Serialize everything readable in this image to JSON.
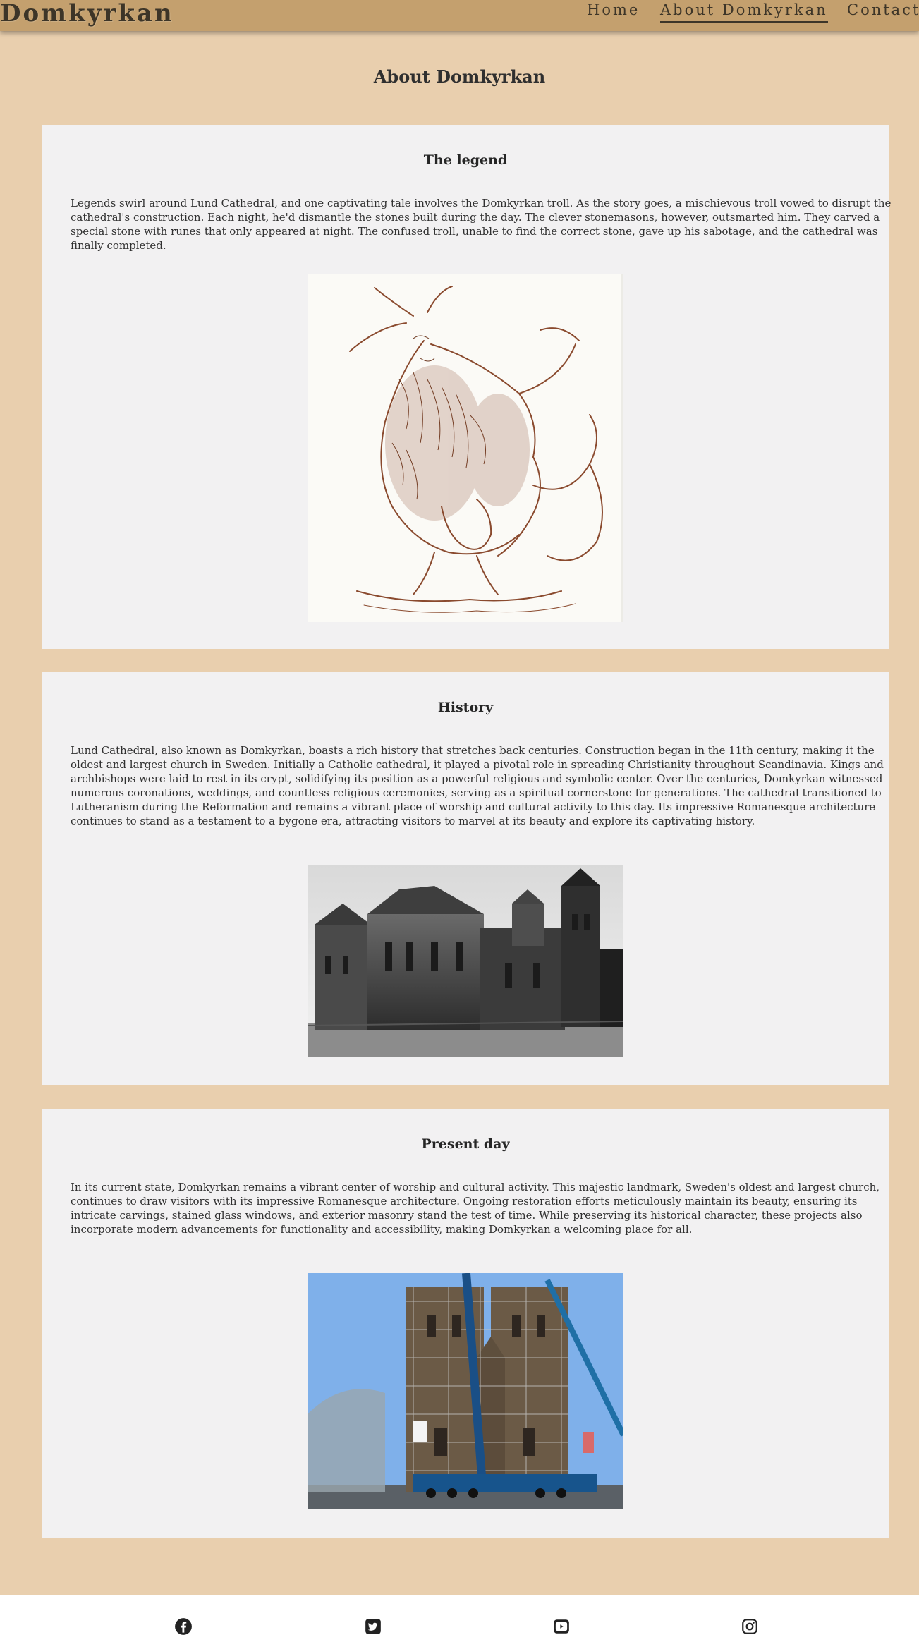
{
  "site": {
    "brand": "Domkyrkan"
  },
  "nav": {
    "items": [
      "Home",
      "About Domkyrkan",
      "Contact"
    ]
  },
  "page": {
    "title": "About Domkyrkan"
  },
  "sections": [
    {
      "heading": "The legend",
      "text": "Legends swirl around Lund Cathedral, and one captivating tale involves the Domkyrkan troll. As the story goes, a mischievous troll vowed to disrupt the cathedral's construction. Each night, he'd dismantle the stones built during the day. The clever stonemasons, however, outsmarted him. They carved a special stone with runes that only appeared at night. The confused troll, unable to find the correct stone, gave up his sabotage, and the cathedral was finally completed."
    },
    {
      "heading": "History",
      "text": "Lund Cathedral, also known as Domkyrkan, boasts a rich history that stretches back centuries. Construction began in the 11th century, making it the oldest and largest church in Sweden. Initially a Catholic cathedral, it played a pivotal role in spreading Christianity throughout Scandinavia. Kings and archbishops were laid to rest in its crypt, solidifying its position as a powerful religious and symbolic center. Over the centuries, Domkyrkan witnessed numerous coronations, weddings, and countless religious ceremonies, serving as a spiritual cornerstone for generations. The cathedral transitioned to Lutheranism during the Reformation and remains a vibrant place of worship and cultural activity to this day. Its impressive Romanesque architecture continues to stand as a testament to a bygone era, attracting visitors to marvel at its beauty and explore its captivating history."
    },
    {
      "heading": "Present day",
      "text": "In its current state, Domkyrkan remains a vibrant center of worship and cultural activity. This majestic landmark, Sweden's oldest and largest church, continues to draw visitors with its impressive Romanesque architecture. Ongoing restoration efforts meticulously maintain its beauty, ensuring its intricate carvings, stained glass windows, and exterior masonry stand the test of time. While preserving its historical character, these projects also incorporate modern advancements for functionality and accessibility, making Domkyrkan a welcoming place for all."
    }
  ],
  "footer": {
    "icons": [
      "facebook-icon",
      "twitter-icon",
      "youtube-icon",
      "instagram-icon"
    ]
  },
  "colors": {
    "background": "#e9cfae",
    "header": "#c4a06e",
    "card": "#f2f1f2",
    "footer": "#ffffff",
    "sky": "#7fb0ea",
    "troll_ink": "#8a4a2e"
  }
}
